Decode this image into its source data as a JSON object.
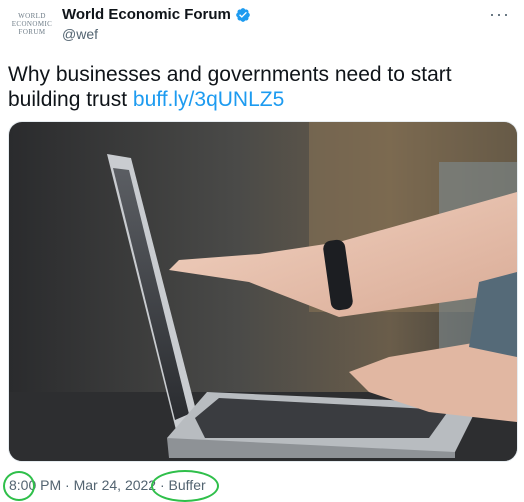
{
  "account": {
    "avatar_lines": [
      "WORLD",
      "ECONOMIC",
      "FORUM"
    ],
    "name": "World Economic Forum",
    "handle": "@wef",
    "verified": true
  },
  "tweet": {
    "text": "Why businesses and governments need to start building trust ",
    "link": "buff.ly/3qUNLZ5",
    "image_alt": "laptop-with-hand-pointing-at-screen"
  },
  "meta": {
    "time": "8:00 PM",
    "sep1": " · ",
    "date": "Mar 24, 2022",
    "sep2": " · ",
    "source": "Buffer"
  },
  "icons": {
    "more": "more-options-icon",
    "verified": "verified-badge-icon"
  },
  "colors": {
    "link": "#1d9bf0",
    "secondary": "#536471",
    "annotation": "#2fbf4a"
  }
}
